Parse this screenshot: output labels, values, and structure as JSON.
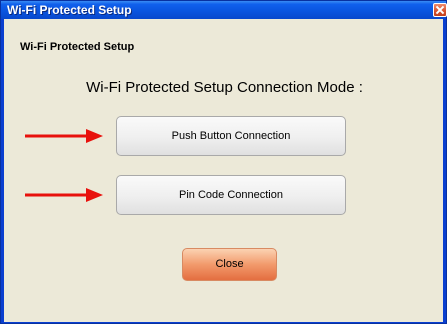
{
  "window": {
    "title": "Wi-Fi Protected Setup"
  },
  "section_label": "Wi-Fi Protected Setup",
  "heading": "Wi-Fi Protected Setup Connection  Mode :",
  "buttons": {
    "push_button": "Push Button Connection",
    "pin_code": "Pin Code Connection",
    "close": "Close"
  },
  "icons": {
    "close": "close-icon",
    "arrow": "arrow-right-icon"
  },
  "colors": {
    "titlebar": "#0a55e0",
    "client_background": "#ece9d8",
    "arrow": "#e8110c",
    "close_button": "#f29a6c"
  }
}
